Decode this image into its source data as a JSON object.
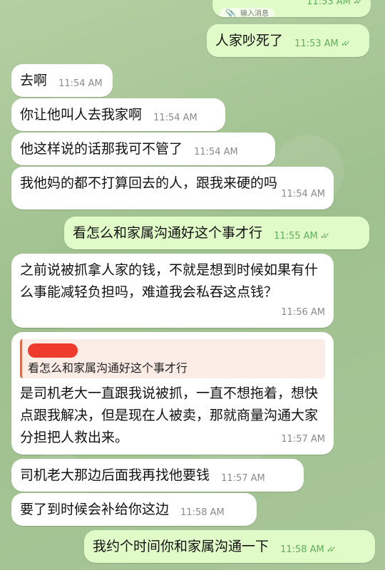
{
  "chat": {
    "messages": [
      {
        "id": "m0",
        "dir": "out",
        "text": "",
        "time": "11:53 AM",
        "read": true,
        "mini_label": "输入消息"
      },
      {
        "id": "m1",
        "dir": "out",
        "text": "人家吵死了",
        "time": "11:53 AM",
        "read": true
      },
      {
        "id": "m2",
        "dir": "in",
        "text": "去啊",
        "time": "11:54 AM"
      },
      {
        "id": "m3",
        "dir": "in",
        "text": "你让他叫人去我家啊",
        "time": "11:54 AM"
      },
      {
        "id": "m4",
        "dir": "in",
        "text": "他这样说的话那我可不管了",
        "time": "11:54 AM"
      },
      {
        "id": "m5",
        "dir": "in",
        "text": "我他妈的都不打算回去的人，跟我来硬的吗",
        "time": "11:54 AM"
      },
      {
        "id": "m6",
        "dir": "out",
        "text": "看怎么和家属沟通好这个事才行",
        "time": "11:55 AM",
        "read": true
      },
      {
        "id": "m7",
        "dir": "in",
        "text": "之前说被抓拿人家的钱，不就是想到时候如果有什么事能减轻负担吗，难道我会私吞这点钱？",
        "time": "11:56 AM"
      },
      {
        "id": "m8",
        "dir": "in",
        "reply_text": "看怎么和家属沟通好这个事才行",
        "text": "是司机老大一直跟我说被抓，一直不想拖着，想快点跟我解决，但是现在人被卖，那就商量沟通大家分担把人救出来。",
        "time": "11:57 AM"
      },
      {
        "id": "m9",
        "dir": "in",
        "text": "司机老大那边后面我再找他要钱",
        "time": "11:57 AM"
      },
      {
        "id": "m10",
        "dir": "in",
        "text": "要了到时候会补给你这边",
        "time": "11:58 AM"
      },
      {
        "id": "m11",
        "dir": "out",
        "text": "我约个时间你和家属沟通一下",
        "time": "11:58 AM",
        "read": true
      }
    ]
  },
  "colors": {
    "incoming_bubble": "#ffffff",
    "outgoing_bubble": "#e1fbc8",
    "outgoing_time": "#5fae5a",
    "incoming_time": "#8a8a8a",
    "reply_bar": "#d86a4a",
    "redaction": "#ef3b2c"
  },
  "icons": {
    "read_receipt": "double-check-icon",
    "attachment": "paperclip-icon"
  }
}
